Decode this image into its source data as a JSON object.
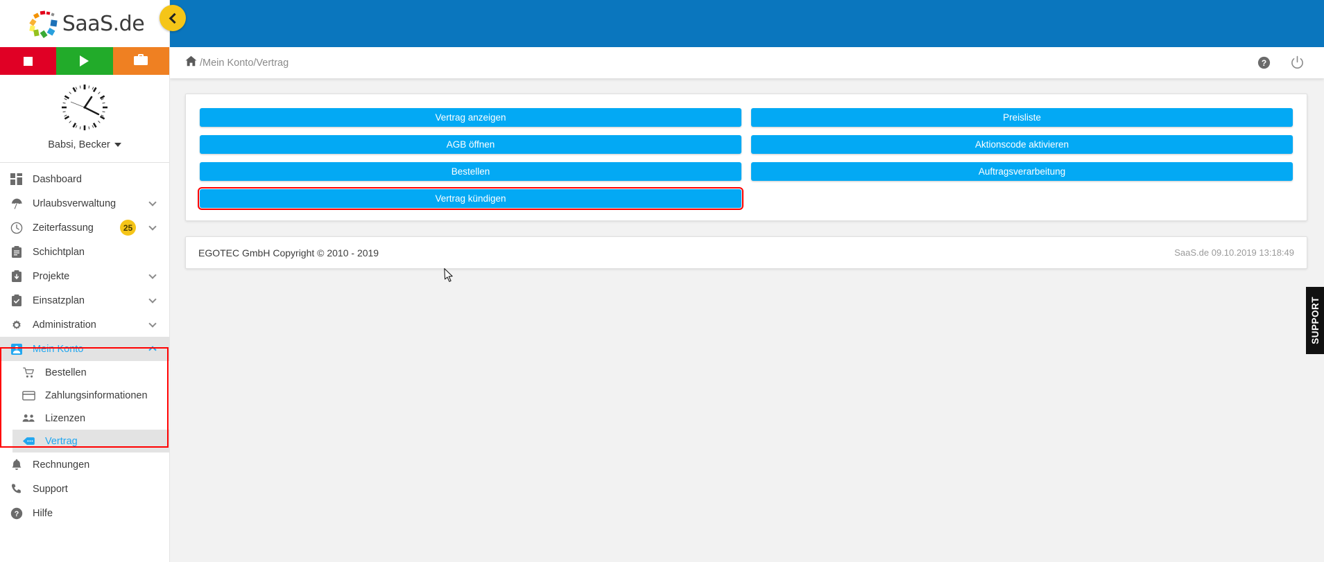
{
  "brand": {
    "name": "SaaS.de",
    "logo_icon": "saas-colorwheel-logo"
  },
  "quickbar": [
    {
      "name": "stop-button",
      "icon": "stop-icon",
      "color": "#e00025"
    },
    {
      "name": "start-button",
      "icon": "play-icon",
      "color": "#22ab2a"
    },
    {
      "name": "business-trip-button",
      "icon": "briefcase-icon",
      "color": "#ef8022"
    }
  ],
  "collapse_button": {
    "icon": "chevron-left-icon",
    "color": "#f5c518"
  },
  "user": {
    "name": "Babsi, Becker",
    "avatar_icon": "analog-clock-icon",
    "caret": "chevron-down-icon"
  },
  "sidebar": {
    "items": [
      {
        "label": "Dashboard",
        "icon": "dashboard-grid-icon",
        "expandable": false,
        "badge": null
      },
      {
        "label": "Urlaubsverwaltung",
        "icon": "beach-umbrella-icon",
        "expandable": true,
        "badge": null
      },
      {
        "label": "Zeiterfassung",
        "icon": "clock-icon",
        "expandable": true,
        "badge": "25"
      },
      {
        "label": "Schichtplan",
        "icon": "clipboard-icon",
        "expandable": false,
        "badge": null
      },
      {
        "label": "Projekte",
        "icon": "clipboard-download-icon",
        "expandable": true,
        "badge": null
      },
      {
        "label": "Einsatzplan",
        "icon": "clipboard-check-icon",
        "expandable": true,
        "badge": null
      },
      {
        "label": "Administration",
        "icon": "gear-icon",
        "expandable": true,
        "badge": null
      },
      {
        "label": "Mein Konto",
        "icon": "user-card-icon",
        "expandable": true,
        "badge": null,
        "active": true
      }
    ],
    "sub_items": [
      {
        "label": "Bestellen",
        "icon": "shopping-cart-icon"
      },
      {
        "label": "Zahlungsinformationen",
        "icon": "credit-card-icon"
      },
      {
        "label": "Lizenzen",
        "icon": "users-icon"
      },
      {
        "label": "Vertrag",
        "icon": "contract-tag-icon",
        "current": true
      }
    ],
    "bottom_items": [
      {
        "label": "Rechnungen",
        "icon": "bell-icon"
      },
      {
        "label": "Support",
        "icon": "phone-icon"
      },
      {
        "label": "Hilfe",
        "icon": "question-circle-icon"
      }
    ]
  },
  "breadcrumb": {
    "home_icon": "home-icon",
    "path": "/Mein Konto/Vertrag"
  },
  "header_actions": [
    {
      "name": "help-icon-button",
      "icon": "question-circle-icon"
    },
    {
      "name": "logout-icon-button",
      "icon": "power-icon"
    }
  ],
  "main": {
    "buttons_left": [
      {
        "label": "Vertrag anzeigen",
        "highlight": false
      },
      {
        "label": "AGB öffnen",
        "highlight": false
      },
      {
        "label": "Bestellen",
        "highlight": false
      },
      {
        "label": "Vertrag kündigen",
        "highlight": true
      }
    ],
    "buttons_right": [
      {
        "label": "Preisliste",
        "highlight": false
      },
      {
        "label": "Aktionscode aktivieren",
        "highlight": false
      },
      {
        "label": "Auftragsverarbeitung",
        "highlight": false
      }
    ]
  },
  "footer": {
    "copyright": "EGOTEC GmbH Copyright © 2010 - 2019",
    "status": "SaaS.de  09.10.2019 13:18:49"
  },
  "support_tab": {
    "label": "SUPPORT"
  },
  "colors": {
    "header_blue": "#0a76be",
    "button_blue": "#03a9f4",
    "accent_yellow": "#f5c518",
    "highlight_red": "#ff0000",
    "active_link": "#22a7f0"
  }
}
